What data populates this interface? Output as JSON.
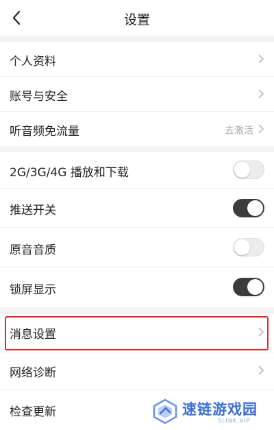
{
  "header": {
    "title": "设置",
    "back_icon": "chevron-left-icon"
  },
  "settings": [
    {
      "label": "个人资料",
      "type": "link"
    },
    {
      "label": "账号与安全",
      "type": "link"
    },
    {
      "label": "听音频免流量",
      "type": "link",
      "hint": "去激活"
    },
    {
      "label": "2G/3G/4G 播放和下载",
      "type": "toggle",
      "on": false
    },
    {
      "label": "推送开关",
      "type": "toggle",
      "on": true
    },
    {
      "label": "原音音质",
      "type": "toggle",
      "on": false
    },
    {
      "label": "锁屏显示",
      "type": "toggle",
      "on": true
    },
    {
      "label": "消息设置",
      "type": "link",
      "highlighted": true
    },
    {
      "label": "网络诊断",
      "type": "link"
    },
    {
      "label": "检查更新",
      "type": "link"
    }
  ],
  "colors": {
    "highlight": "#e0282d",
    "toggle_on": "#3c3c3c",
    "toggle_off": "#ececec",
    "watermark": "#3d6fd8"
  },
  "watermark": {
    "text": "速链游戏园",
    "sub": "SLINK.VIP"
  }
}
